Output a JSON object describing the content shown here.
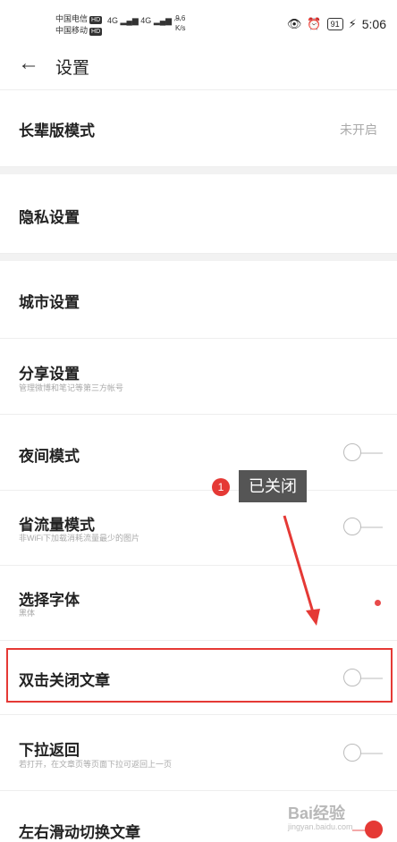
{
  "status_bar": {
    "carrier1": "中国电信",
    "carrier2": "中国移动",
    "hd_badge": "HD",
    "signal1": "4G",
    "signal2": "4G",
    "speed_value": "9.6",
    "speed_unit": "K/s",
    "battery": "91",
    "time": "5:06"
  },
  "header": {
    "title": "设置"
  },
  "rows": {
    "elder_mode": {
      "label": "长辈版模式",
      "value": "未开启"
    },
    "privacy": {
      "label": "隐私设置"
    },
    "city": {
      "label": "城市设置"
    },
    "share": {
      "label": "分享设置",
      "sub": "管理微博和笔记等第三方帐号"
    },
    "night": {
      "label": "夜间模式",
      "on": false
    },
    "data_saver": {
      "label": "省流量模式",
      "sub": "非WiFi下加载消耗流量最少的图片",
      "on": false
    },
    "font": {
      "label": "选择字体",
      "sub": "黑体"
    },
    "double_tap": {
      "label": "双击关闭文章",
      "on": false
    },
    "pull_back": {
      "label": "下拉返回",
      "sub": "若打开，在文章页等页面下拉可返回上一页",
      "on": false
    },
    "swipe": {
      "label": "左右滑动切换文章",
      "on": true
    }
  },
  "annotation": {
    "badge": "1",
    "tooltip": "已关闭"
  },
  "watermark": {
    "text": "Bai经验",
    "domain": "jingyan.baidu.com"
  },
  "colors": {
    "accent": "#e53935",
    "divider": "#eeeeee",
    "section_gap": "#f2f2f2"
  }
}
